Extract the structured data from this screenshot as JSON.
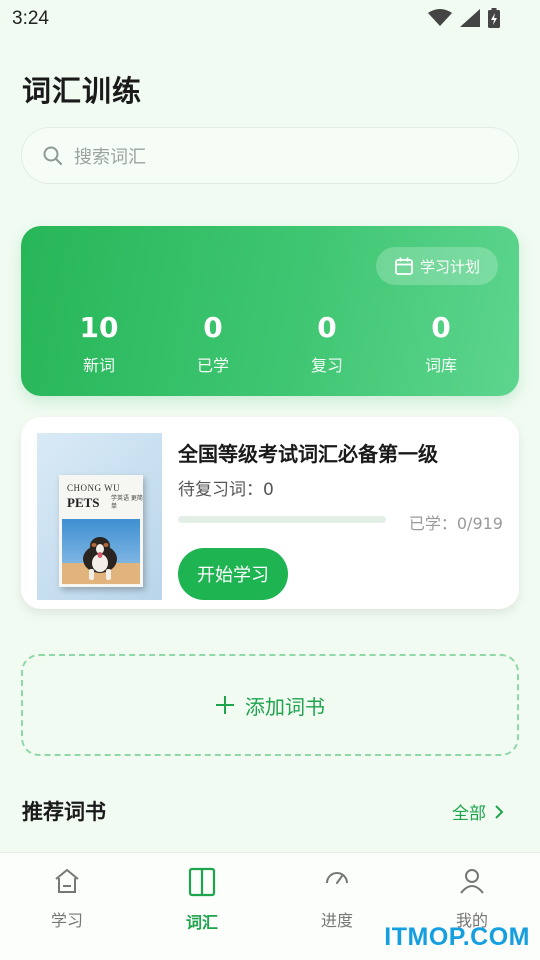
{
  "status_bar": {
    "time": "3:24"
  },
  "header": {
    "title": "词汇训练"
  },
  "search": {
    "placeholder": "搜索词汇"
  },
  "stats_card": {
    "plan_button_label": "学习计划",
    "stats": [
      {
        "value": "10",
        "label": "新词"
      },
      {
        "value": "0",
        "label": "已学"
      },
      {
        "value": "0",
        "label": "复习"
      },
      {
        "value": "0",
        "label": "词库"
      }
    ]
  },
  "book": {
    "cover": {
      "line1": "CHONG WU",
      "line2": "PETS",
      "line3": "学英语 更简单"
    },
    "title": "全国等级考试词汇必备第一级",
    "review_label": "待复习词：0",
    "learned_label": "已学：0/919",
    "progress_fraction": 0,
    "start_label": "开始学习"
  },
  "add_book": {
    "label": "添加词书"
  },
  "recommended": {
    "title": "推荐词书",
    "view_all": "全部"
  },
  "nav": {
    "items": [
      {
        "label": "学习",
        "icon": "home-icon"
      },
      {
        "label": "词汇",
        "icon": "book-icon",
        "active": true
      },
      {
        "label": "进度",
        "icon": "gauge-icon"
      },
      {
        "label": "我的",
        "icon": "user-icon"
      }
    ]
  },
  "watermark": "ITMOP.COM",
  "colors": {
    "accent": "#1fb452",
    "watermark": "#169fe0"
  }
}
